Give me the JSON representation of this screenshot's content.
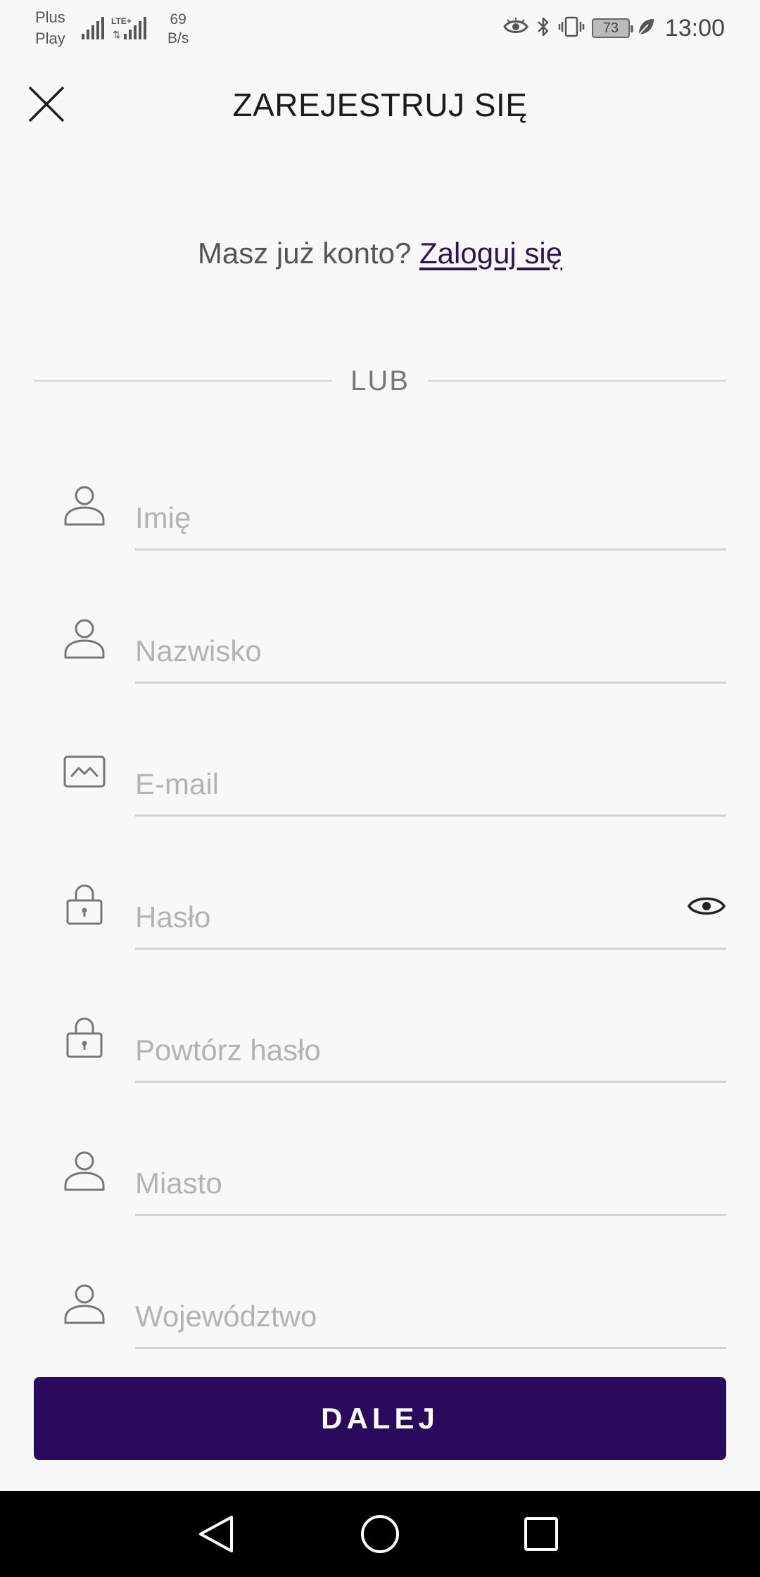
{
  "status_bar": {
    "carrier_line1": "Plus",
    "carrier_line2": "Play",
    "network": "LTE+",
    "speed_value": "69",
    "speed_unit": "B/s",
    "battery": "73",
    "time": "13:00"
  },
  "header": {
    "title": "ZAREJESTRUJ SIĘ",
    "close_icon": "close-icon"
  },
  "login_prompt": {
    "text": "Masz już konto? ",
    "link": "Zaloguj się"
  },
  "divider_text": "LUB",
  "form": {
    "first_name": {
      "placeholder": "Imię",
      "value": "",
      "icon": "person-icon"
    },
    "last_name": {
      "placeholder": "Nazwisko",
      "value": "",
      "icon": "person-icon"
    },
    "email": {
      "placeholder": "E-mail",
      "value": "",
      "icon": "envelope-icon"
    },
    "password": {
      "placeholder": "Hasło",
      "value": "",
      "icon": "lock-icon",
      "toggle_icon": "eye-icon"
    },
    "repeat_password": {
      "placeholder": "Powtórz hasło",
      "value": "",
      "icon": "lock-icon"
    },
    "city": {
      "placeholder": "Miasto",
      "value": "",
      "icon": "person-icon"
    },
    "region": {
      "placeholder": "Województwo",
      "value": "",
      "icon": "person-icon"
    }
  },
  "submit_label": "DALEJ",
  "colors": {
    "accent": "#2a0a5c",
    "link": "#2b1458",
    "background": "#f8f8f8",
    "placeholder": "#b3b3b3"
  }
}
